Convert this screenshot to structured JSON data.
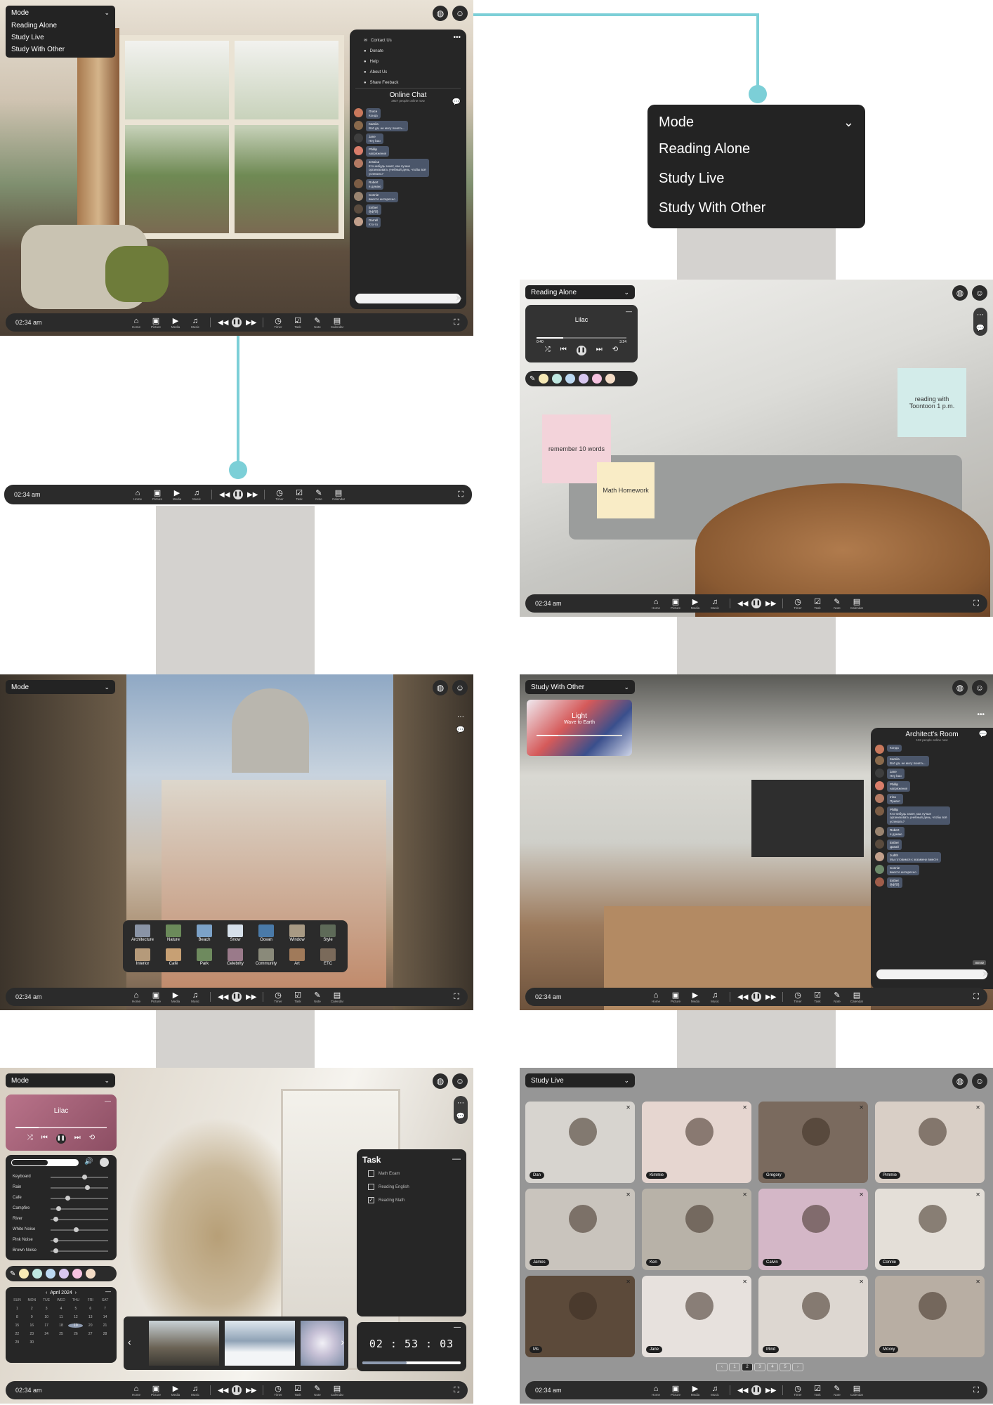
{
  "mode": {
    "label": "Mode",
    "options": [
      "Reading Alone",
      "Study Live",
      "Study With Other"
    ],
    "reading_alone": "Reading Alone",
    "study_with_other": "Study With Other",
    "study_live": "Study Live"
  },
  "toolbar": {
    "time": "02:34 am",
    "tools": [
      "Home",
      "Picture",
      "Media",
      "Music"
    ],
    "tools_right": [
      "Timer",
      "Task",
      "Note",
      "Calendar"
    ]
  },
  "menu": [
    "Contact Us",
    "Donate",
    "Help",
    "About Us",
    "Share Feeback"
  ],
  "online_chat": {
    "title": "Online Chat",
    "subtitle": "2927 people online now",
    "messages": [
      {
        "name": "Grace",
        "text": "Конда"
      },
      {
        "name": "Kamila",
        "text": "Всё да, не могу понять..."
      },
      {
        "name": "Jane",
        "text": "Hey bao"
      },
      {
        "name": "Phillip",
        "text": "напряжения"
      },
      {
        "name": "Jessica",
        "text": "Кто-нибудь знает, как лучше организовать учебный день, чтобы всё успевать?"
      },
      {
        "name": "Robert",
        "text": "я думаю"
      },
      {
        "name": "Connie",
        "text": "вместе интересно"
      },
      {
        "name": "Esther",
        "text": "你好吗"
      },
      {
        "name": "Darrell",
        "text": "Кто-то"
      }
    ]
  },
  "architects_room": {
    "title": "Architect's Room",
    "subtitle": "102 people online now",
    "messages": [
      {
        "name": "",
        "text": "Конда"
      },
      {
        "name": "Kamila",
        "text": "Всё да, не могу понять..."
      },
      {
        "name": "Jane",
        "text": "Hey bao"
      },
      {
        "name": "Phillip",
        "text": "напряжения"
      },
      {
        "name": "Irina",
        "text": "Привет"
      },
      {
        "name": "Phillip",
        "text": "Кто-нибудь знает, как лучше организовать учебный день, чтобы всё успевать?"
      },
      {
        "name": "Robert",
        "text": "я думаю"
      },
      {
        "name": "Esther",
        "text": "Давай"
      },
      {
        "name": "Judith",
        "text": "Мы готовимся к экзамену вместе"
      },
      {
        "name": "Connie",
        "text": "вместе интересно"
      },
      {
        "name": "Esther",
        "text": "你好吗"
      }
    ],
    "badge": "SEND"
  },
  "player_lilac": {
    "title": "Lilac",
    "start": "0:40",
    "end": "3:24"
  },
  "player_light": {
    "title": "Light",
    "subtitle": "Wave to Earth"
  },
  "notes": {
    "note1": "remember 10 words",
    "note2": "Math Homework",
    "note3": "reading with Toontoon 1 p.m."
  },
  "categories": [
    "Architecture",
    "Nature",
    "Beach",
    "Snow",
    "Ocean",
    "Window",
    "Style",
    "Interior",
    "Café",
    "Park",
    "Celebrity",
    "Community",
    "Art",
    "ETC"
  ],
  "sounds": [
    "Keyboard",
    "Rain",
    "Cafe",
    "Campfire",
    "River",
    "White Noise",
    "Pink Noise",
    "Brown Noise"
  ],
  "calendar": {
    "month": "April 2024",
    "days": [
      "SUN",
      "MON",
      "TUE",
      "WED",
      "THU",
      "FRI",
      "SAT"
    ],
    "dates": [
      "1",
      "2",
      "3",
      "4",
      "5",
      "6",
      "7",
      "8",
      "9",
      "10",
      "11",
      "12",
      "13",
      "14",
      "15",
      "16",
      "17",
      "18",
      "19",
      "20",
      "21",
      "22",
      "23",
      "24",
      "25",
      "26",
      "27",
      "28",
      "29",
      "30"
    ],
    "selected": "19"
  },
  "task": {
    "title": "Task",
    "items": [
      {
        "label": "Math Exam",
        "checked": false
      },
      {
        "label": "Reading English",
        "checked": false
      },
      {
        "label": "Reading Math",
        "checked": true
      }
    ]
  },
  "timer": {
    "display": "02 : 53 : 03",
    "progress": 0.45
  },
  "participants": [
    "Dan",
    "Kimmie",
    "Gregory",
    "Pimmie",
    "James",
    "Ken",
    "Calvin",
    "Connie",
    "Ms",
    "Jane",
    "Mind",
    "Moxxy"
  ],
  "pagination": [
    "‹",
    "1",
    "2",
    "3",
    "4",
    "5",
    "›"
  ],
  "current_page": "2",
  "colors": {
    "accent": "#7ccfd7",
    "bar": "#2b2b2b",
    "note_pink": "#f3d3da",
    "note_yellow": "#f9ecc6",
    "note_mint": "#d3ecea"
  },
  "palette": [
    "#f6e9b5",
    "#bfe7e0",
    "#bcd9f2",
    "#d8c7f0",
    "#f6c2e0",
    "#f4dcc6"
  ]
}
